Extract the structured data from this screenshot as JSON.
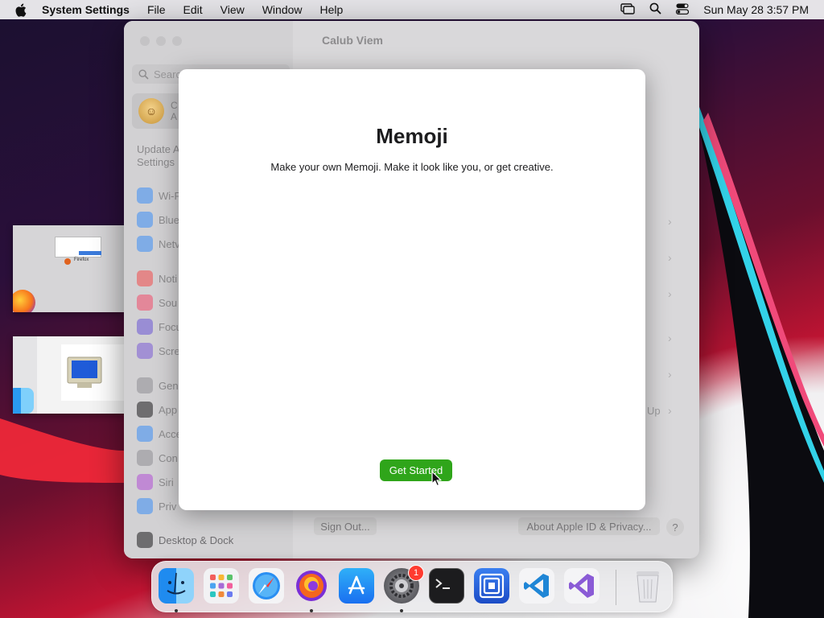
{
  "menubar": {
    "app_name": "System Settings",
    "menus": [
      "File",
      "Edit",
      "View",
      "Window",
      "Help"
    ],
    "clock": "Sun May 28  3:57 PM"
  },
  "settings_window": {
    "title": "Calub Viem",
    "search_placeholder": "Search",
    "account_initial": "C",
    "account_sub": "A",
    "update_text": "Update A Settings",
    "update_line1": "Update A",
    "update_line2": "Settings",
    "sidebar": [
      {
        "label": "Wi-F",
        "icon": "wifi-icon",
        "color": "#3a8ef6"
      },
      {
        "label": "Blue",
        "icon": "bluetooth-icon",
        "color": "#3a8ef6"
      },
      {
        "label": "Netv",
        "icon": "network-icon",
        "color": "#3a8ef6"
      },
      {
        "label": "Noti",
        "icon": "notifications-icon",
        "color": "#f04b4b"
      },
      {
        "label": "Sou",
        "icon": "sound-icon",
        "color": "#f04b6a"
      },
      {
        "label": "Focu",
        "icon": "focus-icon",
        "color": "#6a56d6"
      },
      {
        "label": "Scre",
        "icon": "screen-time-icon",
        "color": "#7a5bd6"
      },
      {
        "label": "Gen",
        "icon": "general-icon",
        "color": "#8e8e93"
      },
      {
        "label": "App",
        "icon": "appearance-icon",
        "color": "#1c1c1e"
      },
      {
        "label": "Acce",
        "icon": "accessibility-icon",
        "color": "#3a8ef6"
      },
      {
        "label": "Con",
        "icon": "control-center-icon",
        "color": "#8e8e93"
      },
      {
        "label": "Siri",
        "icon": "siri-icon",
        "color": "#b04fd6"
      },
      {
        "label": "Priv",
        "icon": "privacy-icon",
        "color": "#3a8ef6"
      },
      {
        "label": "Desktop & Dock",
        "icon": "desktop-dock-icon",
        "color": "#1c1c1e"
      }
    ],
    "bg_up_label": "Up",
    "sign_out_label": "Sign Out...",
    "about_label": "About Apple ID & Privacy...",
    "help_label": "?"
  },
  "thumbnails": {
    "firefox_caption": "Firefox"
  },
  "memoji_sheet": {
    "title": "Memoji",
    "subtitle": "Make your own Memoji. Make it look like you, or get creative.",
    "button_label": "Get Started"
  },
  "dock": {
    "apps": [
      {
        "name": "Finder",
        "icon": "finder-icon",
        "running": true
      },
      {
        "name": "Launchpad",
        "icon": "launchpad-icon",
        "running": false
      },
      {
        "name": "Safari",
        "icon": "safari-icon",
        "running": false
      },
      {
        "name": "Firefox",
        "icon": "firefox-icon",
        "running": true
      },
      {
        "name": "App Store",
        "icon": "app-store-icon",
        "running": false
      },
      {
        "name": "System Settings",
        "icon": "system-settings-icon",
        "running": true,
        "badge": "1"
      },
      {
        "name": "Terminal",
        "icon": "terminal-icon",
        "running": false
      },
      {
        "name": "Screen Sharing",
        "icon": "screen-sharing-icon",
        "running": false
      },
      {
        "name": "Visual Studio Code",
        "icon": "vscode-icon",
        "running": false
      },
      {
        "name": "Visual Studio",
        "icon": "visual-studio-icon",
        "running": false
      }
    ],
    "trash": {
      "name": "Trash",
      "icon": "trash-icon"
    }
  },
  "colors": {
    "accent_green": "#2fa51a",
    "badge_red": "#ff3b30"
  }
}
